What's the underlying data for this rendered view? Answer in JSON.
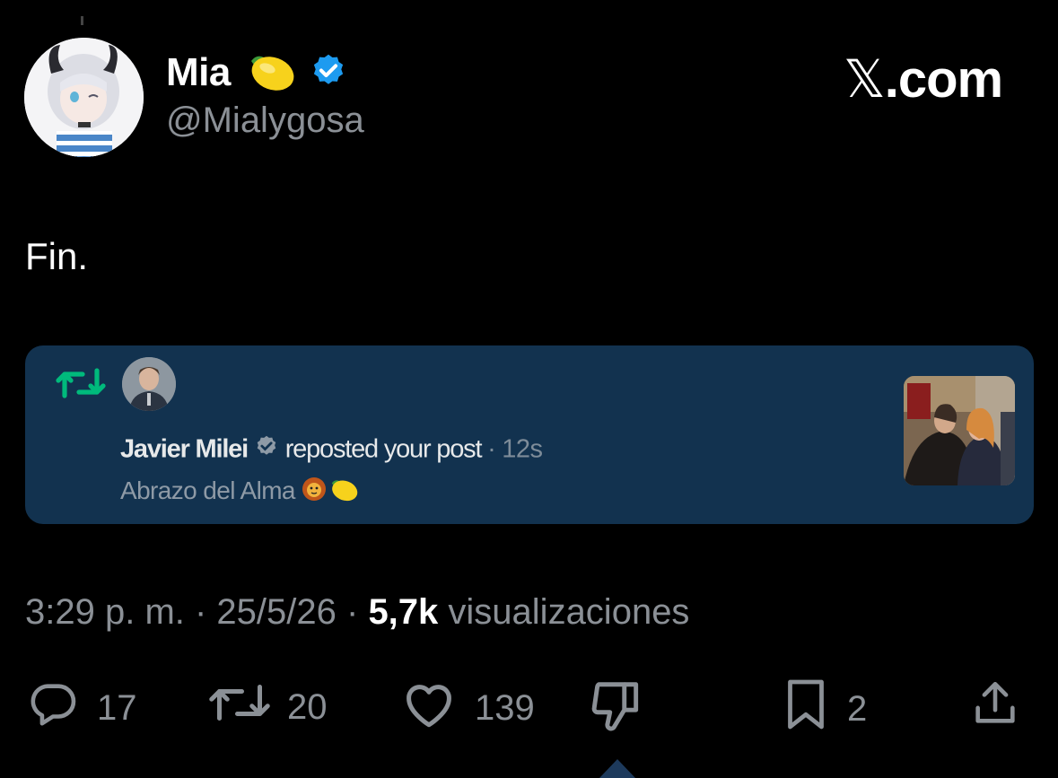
{
  "author": {
    "name": "Mia",
    "handle": "@Mialygosa",
    "name_emoji": "lemon-icon",
    "verified": true,
    "verified_color": "#1d9bf0"
  },
  "brand": {
    "text_x": "𝕏",
    "text_rest": ".com"
  },
  "post": {
    "text": "Fin."
  },
  "notification_card": {
    "background": "#12324f",
    "repost_icon": "repost-icon",
    "repost_icon_color": "#00ba7c",
    "user": "Javier Milei",
    "action": "reposted your post",
    "separator": "·",
    "time": "12s",
    "post_text": "Abrazo del Alma",
    "post_emojis": [
      "lion-icon",
      "lemon-icon"
    ]
  },
  "meta": {
    "time": "3:29 p. m.",
    "sep1": " · ",
    "date": "25/5/26",
    "sep2": " · ",
    "views": "5,7k",
    "views_label": " visualizaciones"
  },
  "actions": {
    "replies": "17",
    "reposts": "20",
    "likes": "139",
    "bookmarks": "2"
  }
}
